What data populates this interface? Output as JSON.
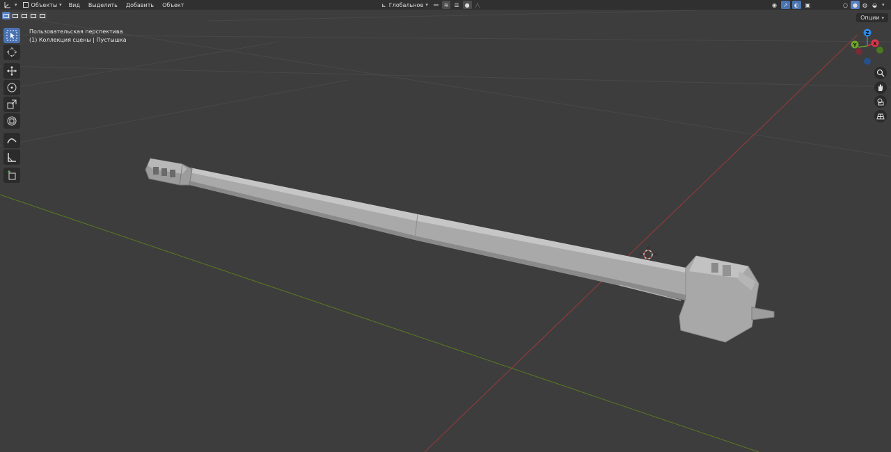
{
  "header": {
    "mode_label": "Объекты",
    "menus": [
      "Вид",
      "Выделить",
      "Добавить",
      "Объект"
    ],
    "orientation_label": "Глобальное"
  },
  "viewport": {
    "view_name": "Пользовательская перспектива",
    "collection_info": "(1) Коллекция сцены | Пустышка",
    "options_label": "Опции"
  },
  "gizmo": {
    "axes": [
      "Z",
      "Y",
      "X"
    ],
    "colors": {
      "x": "#d9364a",
      "y": "#6ca52b",
      "z": "#2d87e6"
    }
  },
  "tools": [
    "select-box-tool",
    "cursor-tool",
    "move-tool",
    "rotate-tool",
    "scale-tool",
    "transform-tool",
    "annotate-tool",
    "measure-tool",
    "add-cube-tool"
  ],
  "nav_controls": [
    "zoom-icon",
    "hand-pan-icon",
    "camera-icon",
    "grid-ortho-icon"
  ],
  "colors": {
    "active_tool": "#4a73b3",
    "viewport_bg": "#3d3d3d",
    "header_bg": "#303030"
  }
}
